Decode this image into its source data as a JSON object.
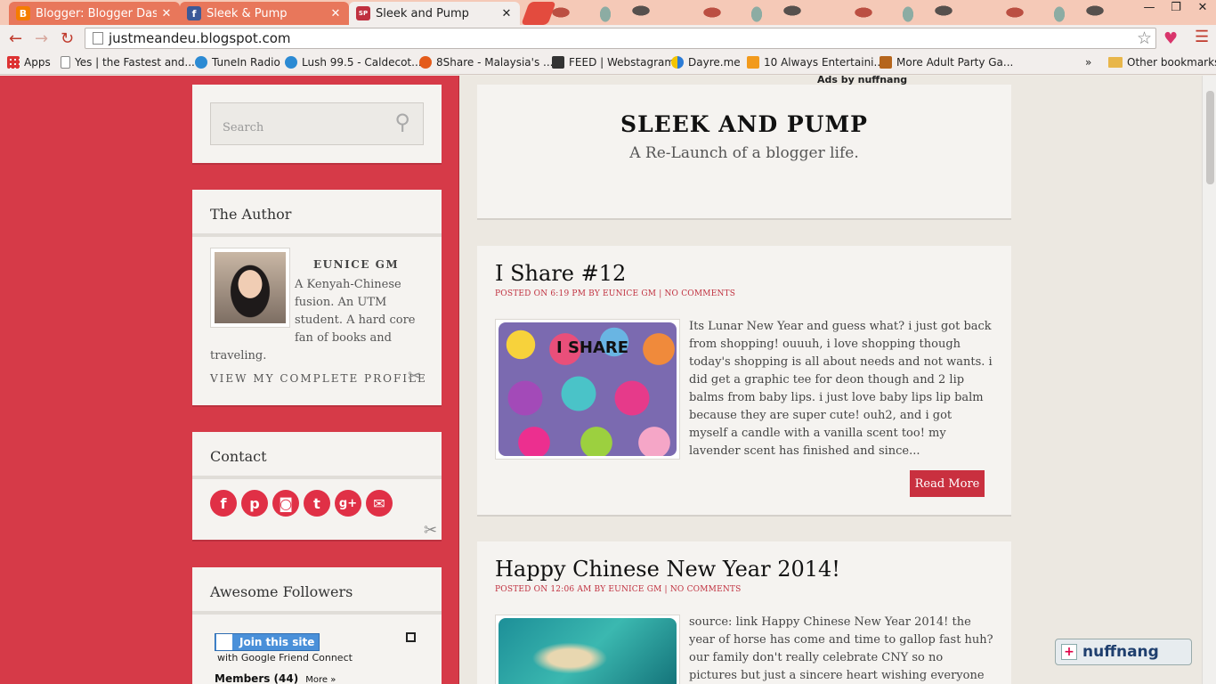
{
  "browser": {
    "tabs": [
      {
        "title": "Blogger: Blogger Dashboa",
        "favicon": "blogger-icon",
        "state": "inactive"
      },
      {
        "title": "Sleek & Pump",
        "favicon": "facebook-icon",
        "state": "inactive"
      },
      {
        "title": "Sleek and Pump",
        "favicon": "blog-favicon",
        "state": "active"
      }
    ],
    "url": "justmeandeu.blogspot.com",
    "bookmarks": [
      {
        "label": "Apps",
        "icon": "apps-grid-icon"
      },
      {
        "label": "Yes | the Fastest and...",
        "icon": "page-icon"
      },
      {
        "label": "TuneIn Radio",
        "icon": "tunein-icon"
      },
      {
        "label": "Lush 99.5 - Caldecot...",
        "icon": "lush-icon"
      },
      {
        "label": "8Share - Malaysia's ...",
        "icon": "8share-icon"
      },
      {
        "label": "FEED | Webstagram",
        "icon": "webstagram-icon"
      },
      {
        "label": "Dayre.me",
        "icon": "dayre-icon"
      },
      {
        "label": "10 Always Entertaini...",
        "icon": "entertain-icon"
      },
      {
        "label": "More Adult Party Ga...",
        "icon": "party-icon"
      },
      {
        "label": "»",
        "icon": ""
      },
      {
        "label": "Other bookmarks",
        "icon": "folder-icon"
      }
    ]
  },
  "sidebar": {
    "search_placeholder": "Search",
    "author": {
      "title": "The Author",
      "name": "EUNICE GM",
      "bio": "A Kenyah-Chinese fusion. An UTM student. A hard core fan of books and traveling.",
      "profile_link": "VIEW MY COMPLETE PROFILE"
    },
    "contact": {
      "title": "Contact",
      "icons": [
        "facebook-icon",
        "pinterest-icon",
        "instagram-icon",
        "tumblr-icon",
        "google-plus-icon",
        "email-icon"
      ]
    },
    "followers": {
      "title": "Awesome Followers",
      "join_button": "Join this site",
      "join_sub": "with Google Friend Connect",
      "members": "Members (44)",
      "more": "More »"
    }
  },
  "header": {
    "title": "SLEEK AND PUMP",
    "description": "A Re-Launch of a blogger life.",
    "ads_strip": "Ads by nuffnang"
  },
  "posts": [
    {
      "title": "I Share #12",
      "meta": "POSTED ON 6:19 PM BY EUNICE GM | NO COMMENTS",
      "thumb_label": "I SHARE",
      "excerpt": "Its Lunar New Year and guess what? i just got back from shopping! ouuuh, i love shopping though today's shopping is all about needs and not wants. i did get a graphic tee for deon though and 2 lip balms from baby lips. i just love baby lips lip balm because they are super cute! ouh2, and i got myself a candle with a vanilla scent too! my lavender scent has finished and since...",
      "read_more": "Read More"
    },
    {
      "title": "Happy Chinese New Year 2014!",
      "meta": "POSTED ON 12:06 AM BY EUNICE GM | NO COMMENTS",
      "excerpt": "source: link Happy Chinese New Year 2014! the year of horse has come and time to gallop fast huh? our family don't really celebrate CNY so no pictures but just a sincere heart wishing everyone happy holiday, happy"
    }
  ],
  "nuffnang_badge": "nuffnang",
  "colors": {
    "sidebar_red": "#d63a48",
    "accent_red": "#c9303f"
  }
}
